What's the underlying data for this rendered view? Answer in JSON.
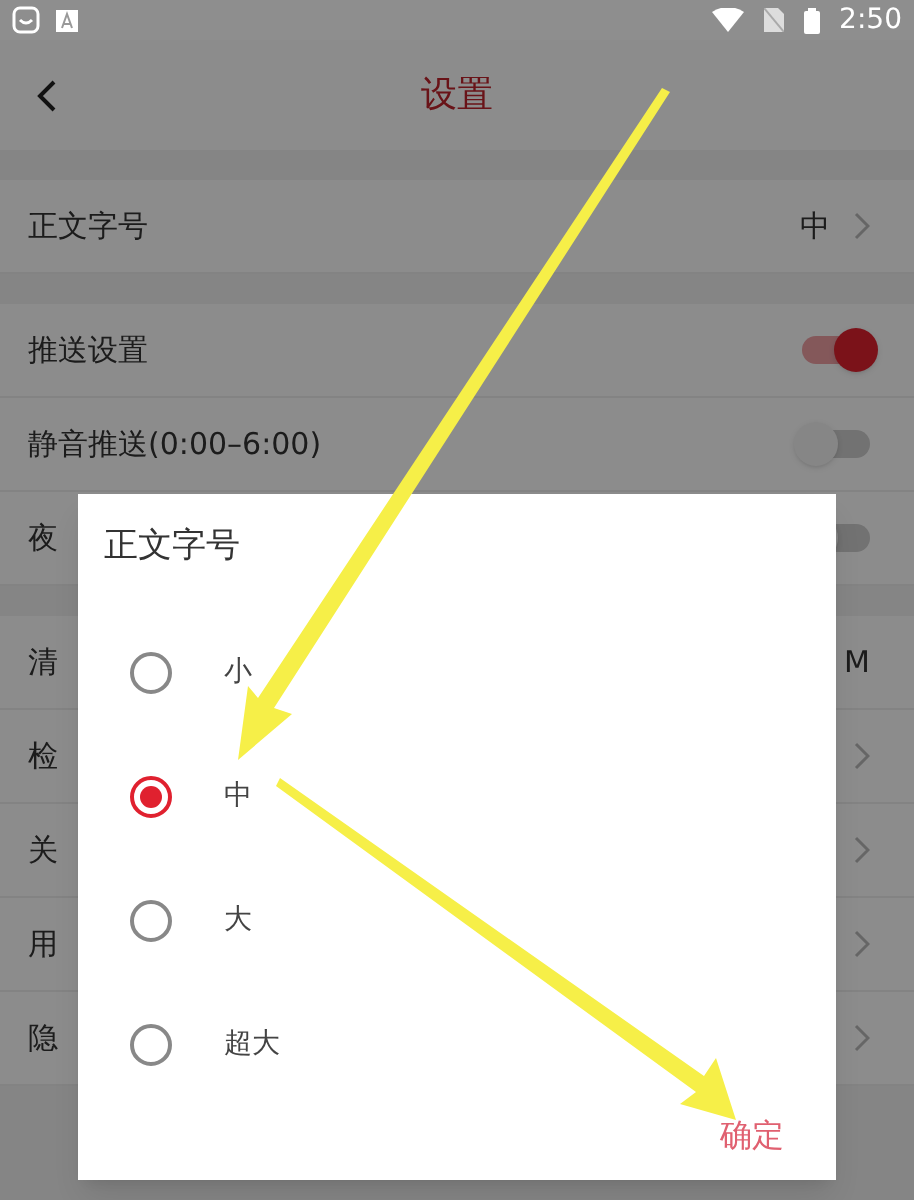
{
  "status_bar": {
    "time": "2:50"
  },
  "header": {
    "title": "设置"
  },
  "groups": [
    [
      {
        "kind": "value",
        "label": "正文字号",
        "value": "中"
      }
    ],
    [
      {
        "kind": "toggle",
        "label": "推送设置",
        "on": true
      },
      {
        "kind": "toggle",
        "label": "静音推送(0:00–6:00)",
        "on": false
      },
      {
        "kind": "toggle",
        "label": "夜",
        "on": false
      }
    ],
    [
      {
        "kind": "info",
        "label": "清",
        "value": "M"
      },
      {
        "kind": "link",
        "label": "检"
      },
      {
        "kind": "link",
        "label": "关"
      },
      {
        "kind": "link",
        "label": "用"
      },
      {
        "kind": "link",
        "label": "隐"
      }
    ]
  ],
  "dialog": {
    "title": "正文字号",
    "options": [
      {
        "label": "小",
        "selected": false
      },
      {
        "label": "中",
        "selected": true
      },
      {
        "label": "大",
        "selected": false
      },
      {
        "label": "超大",
        "selected": false
      }
    ],
    "confirm": "确定"
  }
}
